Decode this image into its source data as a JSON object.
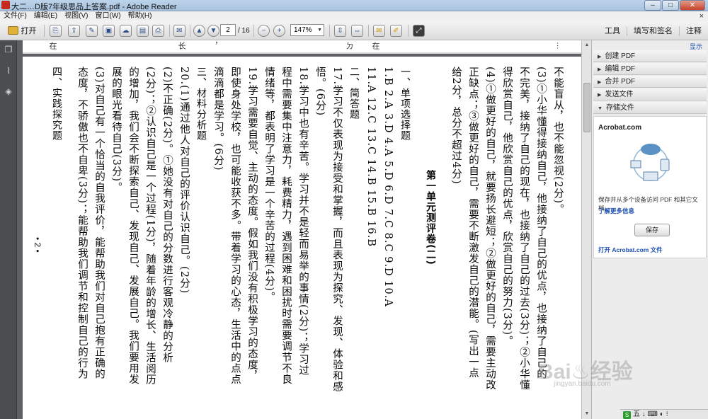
{
  "window": {
    "title": "大二…D版7年级思品上答案.pdf - Adobe Reader",
    "buttons": [
      "–",
      "□",
      "✕"
    ]
  },
  "menu": {
    "items": [
      "文件(F)",
      "编辑(E)",
      "视图(V)",
      "窗口(W)",
      "帮助(H)"
    ],
    "close": "×"
  },
  "toolbar": {
    "open_label": "打开",
    "page_current": "2",
    "page_total": "/ 16",
    "zoom": "147%",
    "right_links": [
      "工具",
      "填写和签名",
      "注释"
    ]
  },
  "document": {
    "top_fragments": [
      "在",
      "长",
      "，",
      "ㄉ",
      "在",
      "…"
    ],
    "columns": [
      {
        "kind": "text",
        "text": "不能盲从，也不能忽视(2分)。"
      },
      {
        "kind": "text",
        "text": "(3)①小华懂得接纳自己，他接纳了自己的优点，也接纳了自己的"
      },
      {
        "kind": "text",
        "text": "不完美，接纳了自己的现在，也接纳了自己的过去(3分)；②小华懂"
      },
      {
        "kind": "text",
        "text": "得欣赏自己，他欣赏自己的优点，欣赏自己的努力(3分)。"
      },
      {
        "kind": "text",
        "text": "(4)①做更好的自己，就要扬长避短；②做更好的自己，需要主动改"
      },
      {
        "kind": "text",
        "text": "正缺点；③做更好的自己，需要不断激发自己的潜能。(写出一点"
      },
      {
        "kind": "text",
        "text": "给2分，总分不超过4分)"
      },
      {
        "kind": "gap",
        "text": ""
      },
      {
        "kind": "title",
        "text": "第一单元测评卷(二)"
      },
      {
        "kind": "gap",
        "text": ""
      },
      {
        "kind": "sec",
        "text": "一、单项选择题"
      },
      {
        "kind": "text",
        "text": "1.B  2.A  3.D  4.A  5.D  6.D  7.C  8.C  9.D  10.A"
      },
      {
        "kind": "text",
        "text": "11.A  12.C  13.C  14.B  15.B  16.B"
      },
      {
        "kind": "sec",
        "text": "二、简答题"
      },
      {
        "kind": "text",
        "text": "17.学习不仅表现为接受和掌握，而且表现为探究、发现、体验和感"
      },
      {
        "kind": "text",
        "text": "悟。(6分)"
      },
      {
        "kind": "text",
        "text": "18.学习中也有辛苦。学习并不是轻而易举的事情(2分)；学习过"
      },
      {
        "kind": "text",
        "text": "程中需要集中注意力，耗费精力，遇到困难和困扰时需要调节不良"
      },
      {
        "kind": "text",
        "text": "情绪等，都表明了学习是一个辛苦的过程(4分)。"
      },
      {
        "kind": "text",
        "text": "19.学习需要自觉、主动的态度。假如我们没有积极学习的态度，"
      },
      {
        "kind": "text",
        "text": "即使身处学校，也可能收获不多。带着学习的心态，生活中的点点"
      },
      {
        "kind": "text",
        "text": "滴滴都是学习。(6分)"
      },
      {
        "kind": "sec",
        "text": "三、材料分析题"
      },
      {
        "kind": "text",
        "text": "20.(1)通过他人对自己的评价认识自己。(2分)"
      },
      {
        "kind": "text",
        "text": "(2)不正确(2分)。①她没有对自己的分数进行客观冷静的分析"
      },
      {
        "kind": "text",
        "text": "(2分)；②认识自己是一个过程(1分)，随着年龄的增长、生活阅历"
      },
      {
        "kind": "text",
        "text": "的增加，我们会不断探索自己、发现自己、发展自己。我们要用发"
      },
      {
        "kind": "text",
        "text": "展的眼光看待自己(3分)。"
      },
      {
        "kind": "text",
        "text": "(3)对自己有一个恰当的自我评价，能帮助我们对自己抱有正确的"
      },
      {
        "kind": "text",
        "text": "态度，不骄傲也不自卑(3分)；能帮助我们调节和控制自己的行为"
      },
      {
        "kind": "gap",
        "text": ""
      },
      {
        "kind": "sec",
        "text": "四、实践探究题"
      }
    ],
    "page_number": "• 2 •"
  },
  "right_panel": {
    "show_label": "显示",
    "items": [
      "创建 PDF",
      "编辑 PDF",
      "合并 PDF",
      "发送文件",
      "存储文件"
    ],
    "card_brand": "Acrobat.com",
    "card_desc": "保存并从多个设备访问 PDF 和其它文档。",
    "learn_more": "了解更多信息",
    "save_button": "保存",
    "open_link": "打开 Acrobat.com 文件"
  },
  "watermark": {
    "main": "Bai♨经验",
    "sub": "jingyan.baidu.com"
  },
  "tray": {
    "text": "五 ↓ ⌨ ◐ ⁝"
  }
}
